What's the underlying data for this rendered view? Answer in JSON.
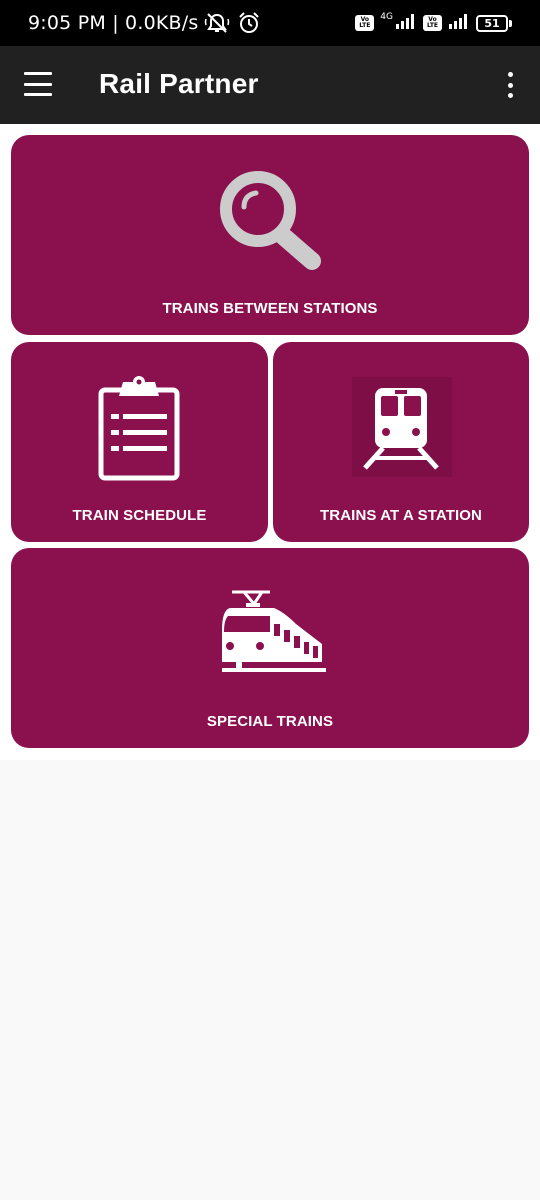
{
  "status_bar": {
    "time_speed": "9:05 PM | 0.0KB/s",
    "network_type": "4G",
    "volte_label": "Vo LTE",
    "battery": "51"
  },
  "app_bar": {
    "title": "Rail Partner"
  },
  "cards": {
    "trains_between_stations": "TRAINS BETWEEN STATIONS",
    "train_schedule": "TRAIN SCHEDULE",
    "trains_at_a_station": "TRAINS AT A STATION",
    "special_trains": "SPECIAL TRAINS"
  },
  "colors": {
    "card_background": "#8b104e",
    "app_bar": "#212121",
    "status_bar": "#000000",
    "search_icon": "#cccccc"
  }
}
